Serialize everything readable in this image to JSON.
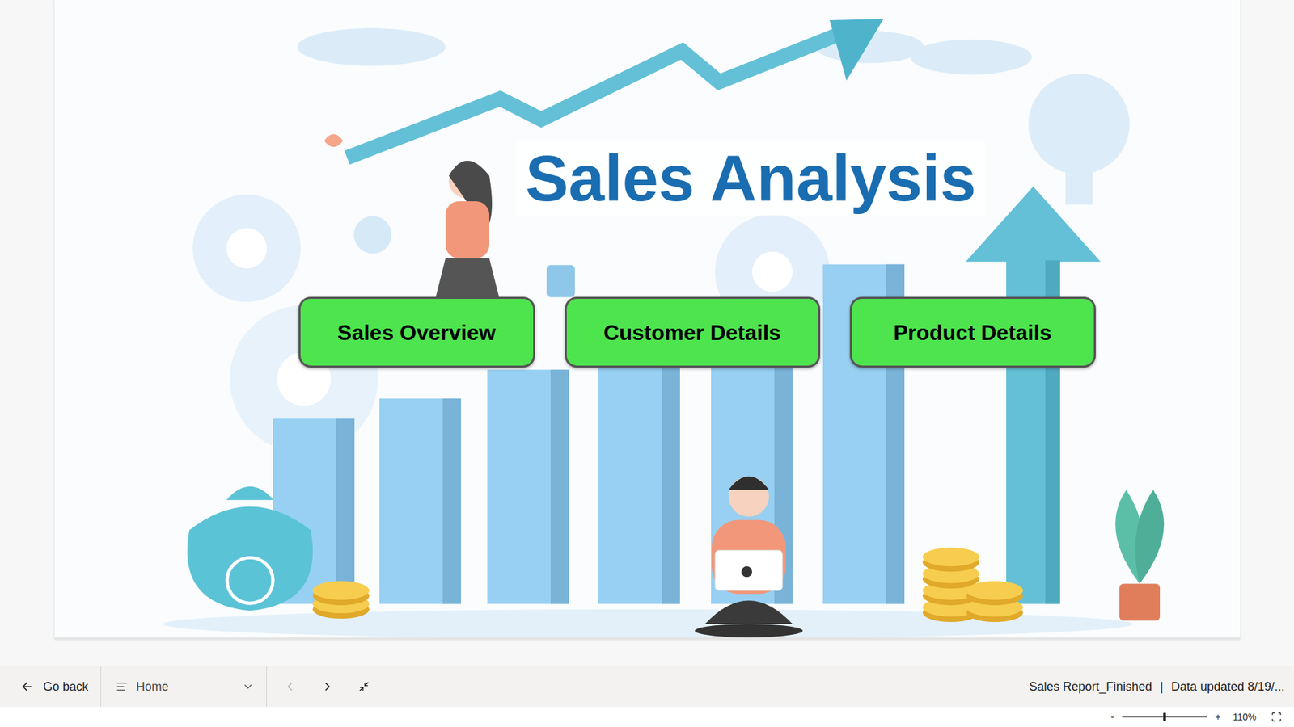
{
  "report": {
    "title": "Sales Analysis",
    "buttons": [
      {
        "label": "Sales Overview"
      },
      {
        "label": "Customer Details"
      },
      {
        "label": "Product Details"
      }
    ]
  },
  "nav": {
    "back": "Go back",
    "page": "Home",
    "prev_enabled": false,
    "next_enabled": true,
    "report_name": "Sales Report_Finished",
    "separator": "|",
    "data_updated": "Data updated 8/19/..."
  },
  "zoom": {
    "minus": "-",
    "plus": "+",
    "level": 0.5,
    "reading": "110%"
  }
}
